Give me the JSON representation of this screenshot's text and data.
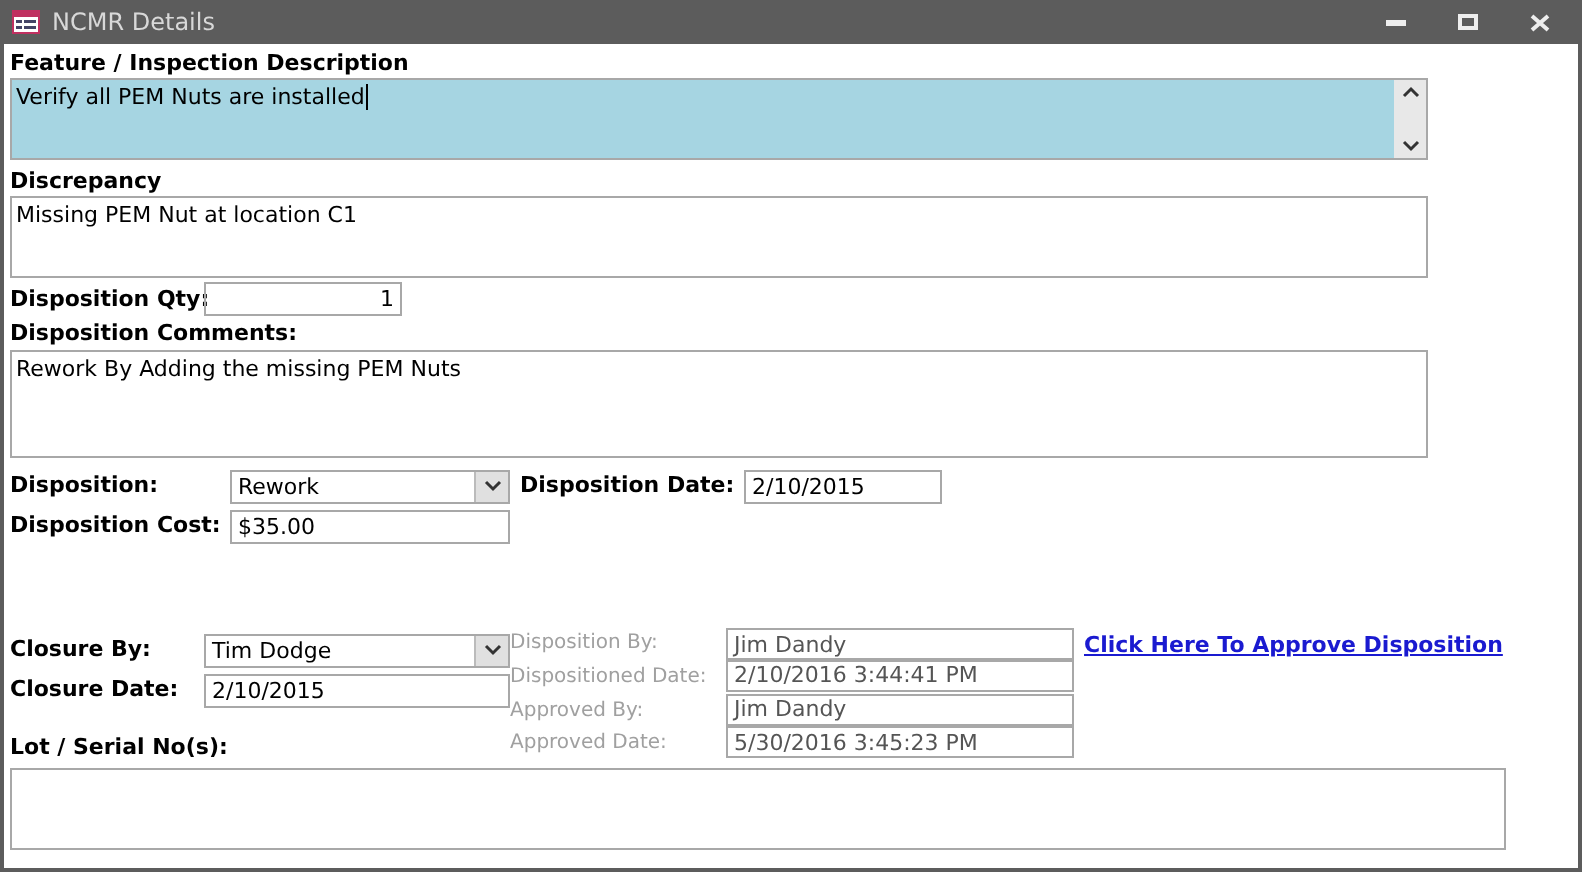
{
  "window": {
    "title": "NCMR Details"
  },
  "feature": {
    "label": "Feature / Inspection Description",
    "value": "Verify all PEM Nuts are installed",
    "focused": true
  },
  "discrepancy": {
    "label": "Discrepancy",
    "value": "Missing PEM Nut at location C1"
  },
  "qty": {
    "label": "Disposition Qty:",
    "value": "1"
  },
  "comments": {
    "label": "Disposition Comments:",
    "value": "Rework By Adding the missing PEM Nuts"
  },
  "disposition": {
    "label": "Disposition:",
    "value": "Rework"
  },
  "disposition_date": {
    "label": "Disposition Date:",
    "value": "2/10/2015"
  },
  "cost": {
    "label": "Disposition Cost:",
    "value": "$35.00"
  },
  "closure_by": {
    "label": "Closure By:",
    "value": "Tim Dodge"
  },
  "closure_date": {
    "label": "Closure Date:",
    "value": "2/10/2015"
  },
  "approval": [
    {
      "label": "Disposition By:",
      "value": "Jim Dandy"
    },
    {
      "label": "Dispositioned Date:",
      "value": "2/10/2016 3:44:41 PM"
    },
    {
      "label": "Approved By:",
      "value": "Jim Dandy"
    },
    {
      "label": "Approved Date:",
      "value": "5/30/2016 3:45:23 PM"
    }
  ],
  "approve_link": "Click Here To Approve Disposition",
  "lot": {
    "label": "Lot / Serial No(s):"
  }
}
